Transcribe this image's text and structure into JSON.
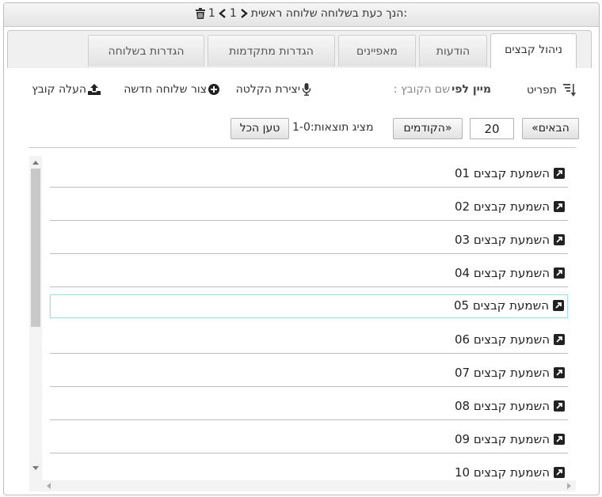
{
  "title": {
    "prefix": "הנך כעת בשלוחה:",
    "main": "שלוחה ראשית",
    "crumb1": "1",
    "crumb2": "1"
  },
  "tabs": [
    {
      "label": "ניהול קבצים",
      "active": true
    },
    {
      "label": "הודעות",
      "active": false
    },
    {
      "label": "מאפיינים",
      "active": false
    },
    {
      "label": "הגדרות מתקדמות",
      "active": false
    },
    {
      "label": "הגדרות בשלוחה",
      "active": false
    }
  ],
  "toolbar": {
    "menu_label": "תפריט",
    "sort_by_label": "מיין לפי",
    "sort_value": ": שם הקובץ",
    "record_label": "יצירת הקלטה",
    "new_ext_label": "צור שלוחה חדשה",
    "upload_label": "העלה קובץ"
  },
  "pager": {
    "next_label": "«הבאים",
    "page_size": "20",
    "prev_label": "הקודמים»",
    "status": "מציג תוצאות:1-0",
    "load_all_label": "טען הכל"
  },
  "files": [
    {
      "label": "01 השמעת קבצים"
    },
    {
      "label": "02 השמעת קבצים"
    },
    {
      "label": "03 השמעת קבצים"
    },
    {
      "label": "04 השמעת קבצים"
    },
    {
      "label": "05 השמעת קבצים",
      "selected": true
    },
    {
      "label": "06 השמעת קבצים"
    },
    {
      "label": "07 השמעת קבצים"
    },
    {
      "label": "08 השמעת קבצים"
    },
    {
      "label": "09 השמעת קבצים"
    },
    {
      "label": "10 השמעת קבצים"
    }
  ],
  "colors": {
    "selected_border": "#a9dcdc",
    "tab_active_bg": "#ffffff"
  }
}
